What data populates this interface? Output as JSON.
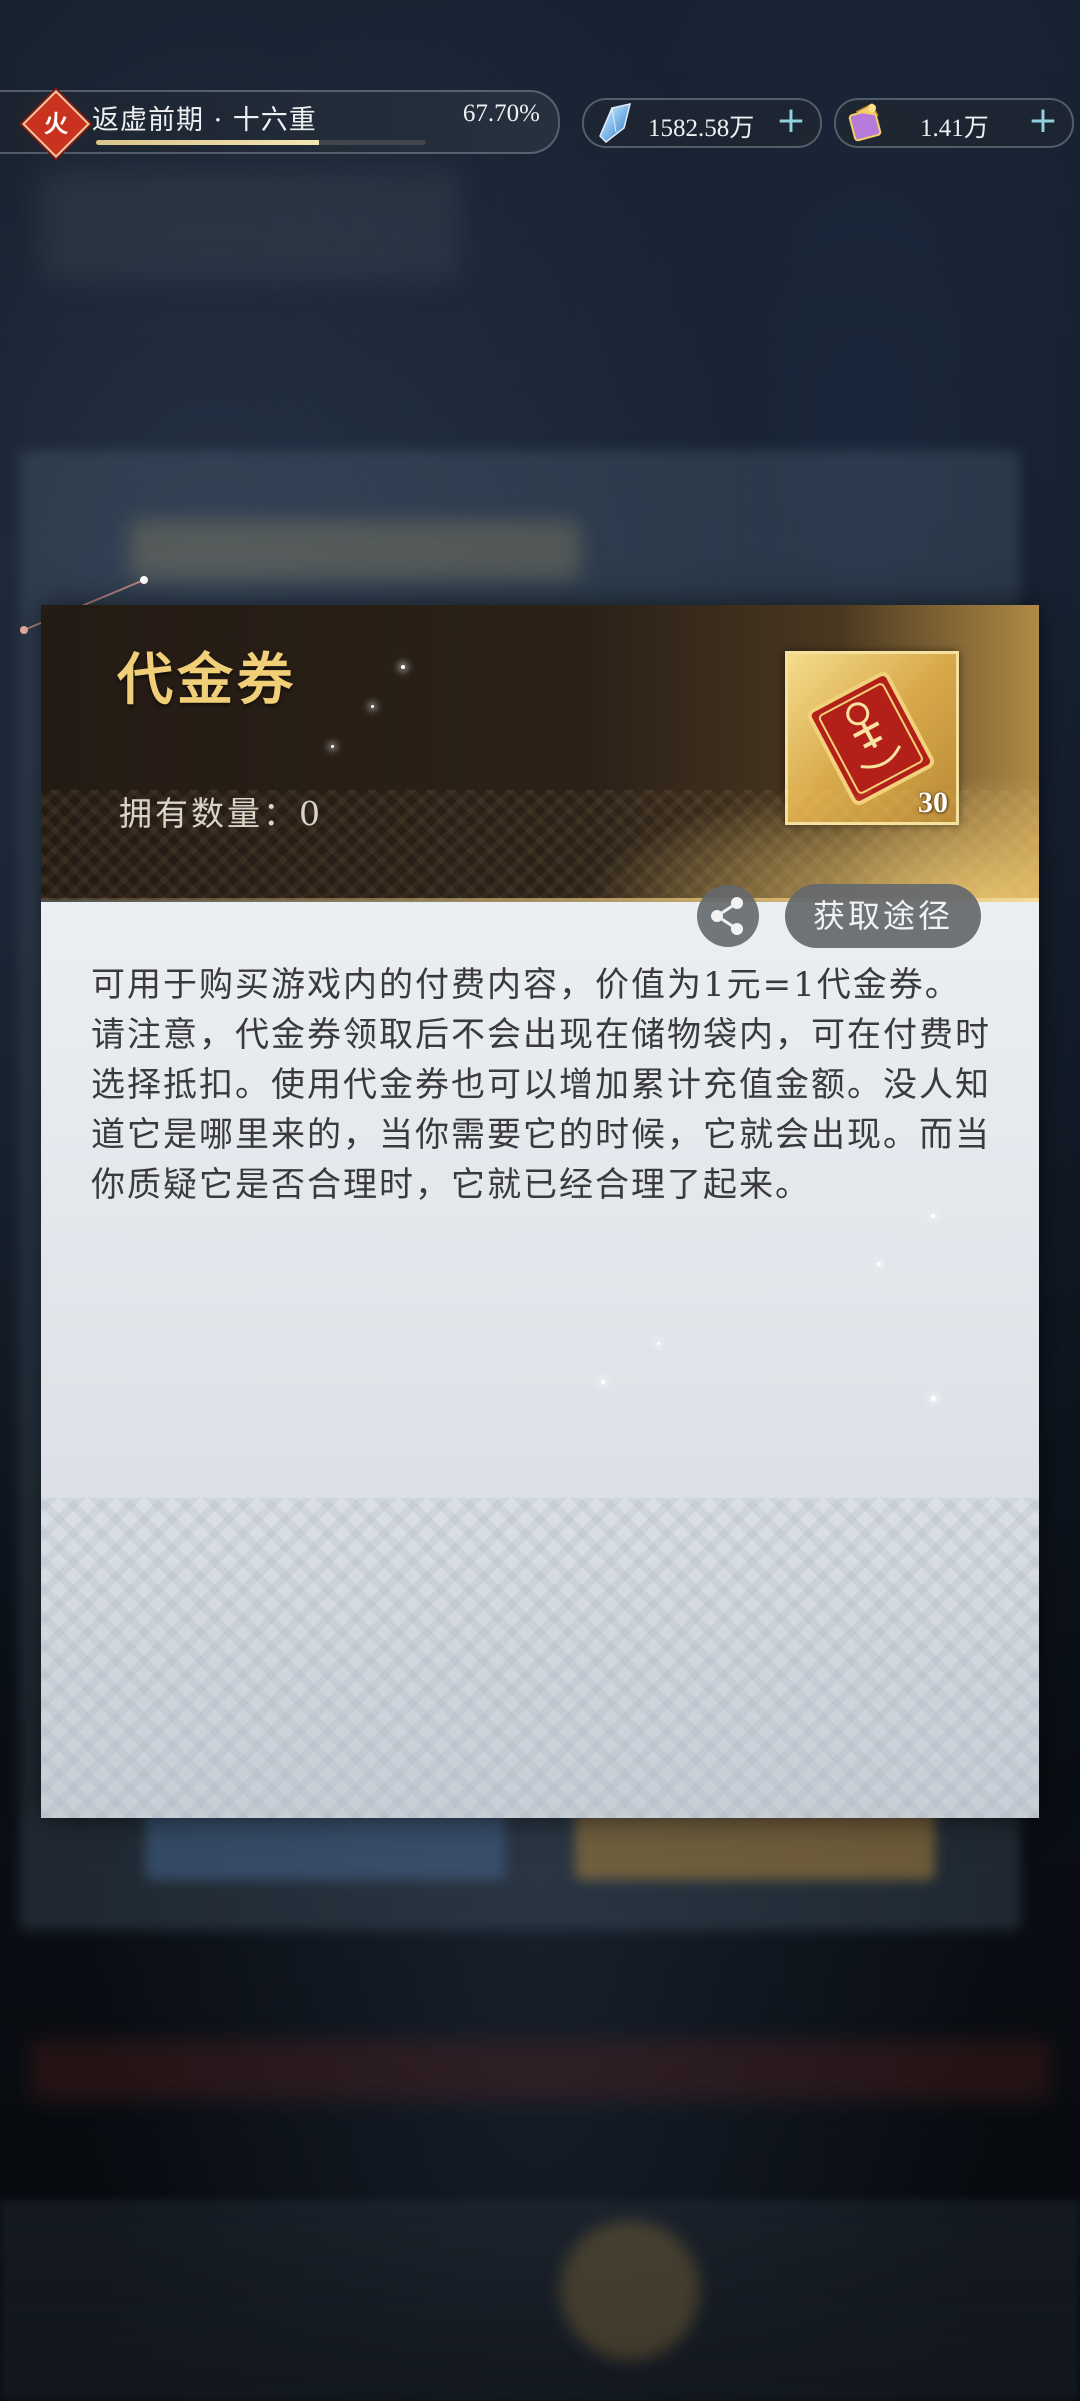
{
  "status_bar": {
    "element_badge": "火",
    "realm_name": "返虚前期 · 十六重",
    "realm_progress": "67.70%",
    "realm_progress_fraction": 0.677,
    "resources": [
      {
        "icon": "spirit-stone-icon",
        "value": "1582.58万"
      },
      {
        "icon": "scroll-icon",
        "value": "1.41万"
      }
    ]
  },
  "item_dialog": {
    "title": "代金券",
    "owned_label": "拥有数量：0",
    "icon": "voucher-ticket-icon",
    "icon_count": "30",
    "share_icon": "share-icon",
    "source_button": "获取途径",
    "description": "可用于购买游戏内的付费内容，价值为1元=1代金券。请注意，代金券领取后不会出现在储物袋内，可在付费时选择抵扣。使用代金券也可以增加累计充值金额。没人知道它是哪里来的，当你需要它的时候，它就会出现。而当你质疑它是否合理时，它就已经合理了起来。"
  },
  "colors": {
    "title_gold": "#f0cf78",
    "header_dark": "#241b14",
    "body_light": "#ebeef2",
    "fire_red": "#c8321e",
    "plus_cyan": "#8fd2de"
  }
}
